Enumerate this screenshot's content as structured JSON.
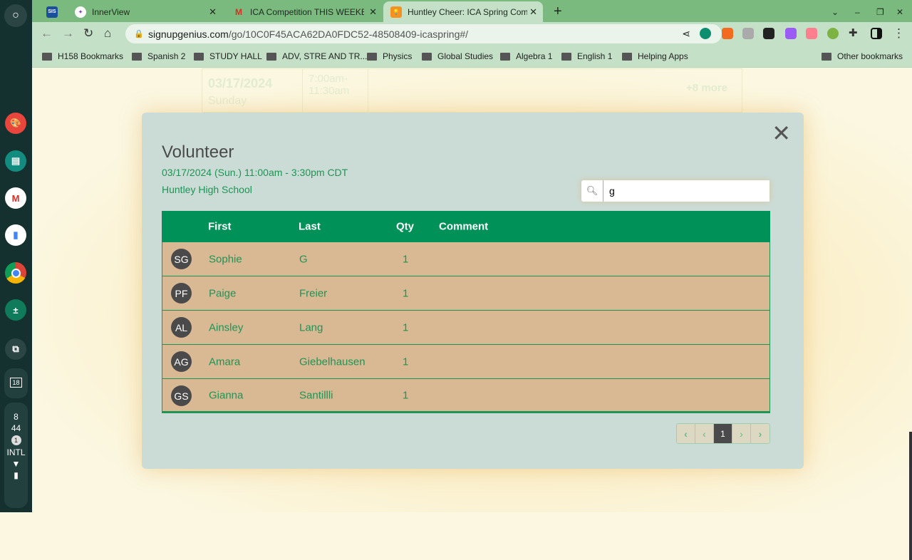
{
  "shelf": {
    "time_hour": "8",
    "time_min": "44",
    "notif_count": "1",
    "ime": "INTL",
    "calendar_day": "18"
  },
  "tabs": [
    {
      "label": "",
      "icon": "SIS"
    },
    {
      "label": "InnerView"
    },
    {
      "label": "ICA Competition THIS WEEKEND"
    },
    {
      "label": "Huntley Cheer: ICA Spring Comp"
    }
  ],
  "address": {
    "domain": "signupgenius.com",
    "path": "/go/10C0F45ACA62DA0FDC52-48508409-icaspring#/"
  },
  "bookmarks": [
    "H158 Bookmarks",
    "Spanish 2",
    "STUDY HALL",
    "ADV, STRE AND TR...",
    "Physics",
    "Global Studies",
    "Algebra 1",
    "English 1",
    "Helping Apps"
  ],
  "other_bookmarks": "Other bookmarks",
  "background": {
    "date": "03/17/2024",
    "day": "Sunday",
    "time": "7:00am-11:30am",
    "more": "+8 more"
  },
  "modal": {
    "title": "Volunteer",
    "datetime": "03/17/2024 (Sun.)  11:00am - 3:30pm CDT",
    "location": "Huntley High School",
    "search_value": "g",
    "columns": [
      "First",
      "Last",
      "Qty",
      "Comment"
    ],
    "rows": [
      {
        "initials": "SG",
        "first": "Sophie",
        "last": "G",
        "qty": "1",
        "comment": ""
      },
      {
        "initials": "PF",
        "first": "Paige",
        "last": "Freier",
        "qty": "1",
        "comment": ""
      },
      {
        "initials": "AL",
        "first": "Ainsley",
        "last": "Lang",
        "qty": "1",
        "comment": ""
      },
      {
        "initials": "AG",
        "first": "Amara",
        "last": "Giebelhausen",
        "qty": "1",
        "comment": ""
      },
      {
        "initials": "GS",
        "first": "Gianna",
        "last": "Santillli",
        "qty": "1",
        "comment": ""
      }
    ],
    "current_page": "1"
  }
}
